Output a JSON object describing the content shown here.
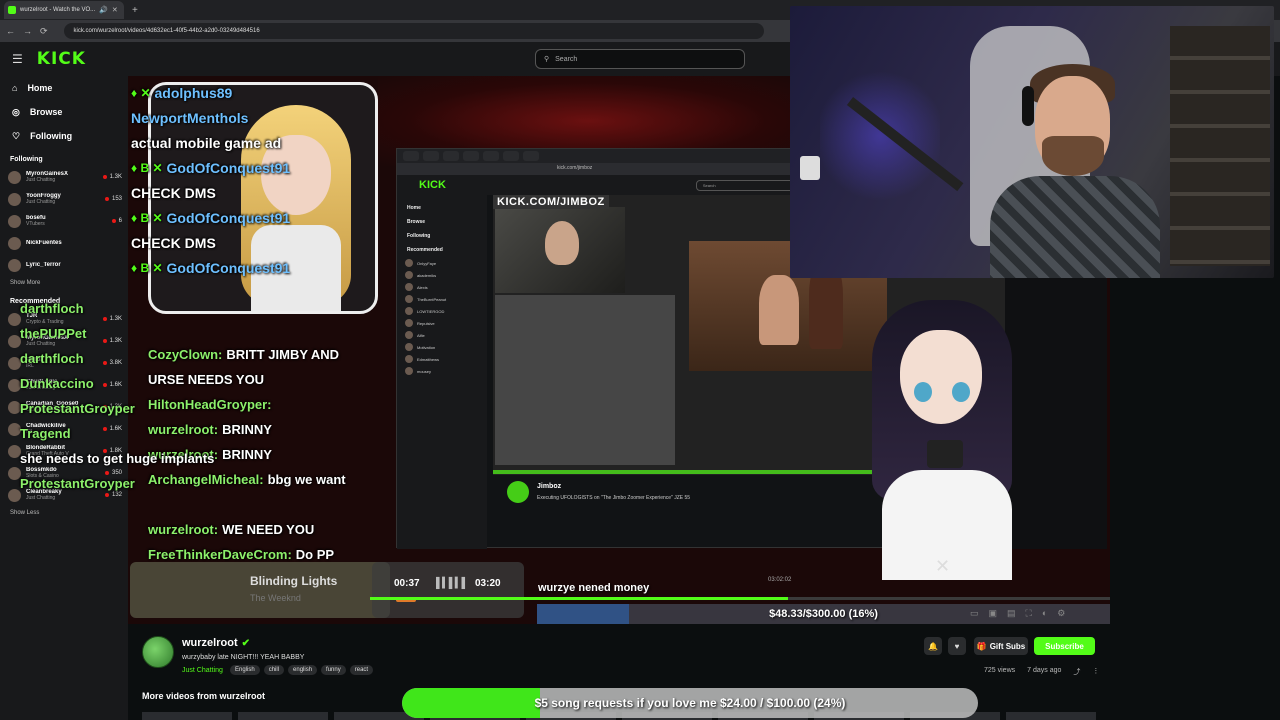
{
  "browser": {
    "tab_title": "wurzelroot - Watch the VO...",
    "url": "kick.com/wurzelroot/videos/4d632ec1-40f5-44b2-a2d0-03249d484516"
  },
  "header": {
    "logo": "KICK",
    "search_placeholder": "Search"
  },
  "sidebar": {
    "nav": [
      {
        "label": "Home",
        "icon": "home-icon"
      },
      {
        "label": "Browse",
        "icon": "compass-icon"
      },
      {
        "label": "Following",
        "icon": "heart-icon"
      }
    ],
    "following_title": "Following",
    "following": [
      {
        "name": "MyronGainesX",
        "cat": "Just Chatting",
        "count": "1.3K"
      },
      {
        "name": "YoonFroggy",
        "cat": "Just Chatting",
        "count": "153"
      },
      {
        "name": "bosefu",
        "cat": "VTubers",
        "count": "6"
      },
      {
        "name": "NickFuentes",
        "cat": "",
        "count": ""
      },
      {
        "name": "Lyric_Terror",
        "cat": "",
        "count": ""
      }
    ],
    "show_more": "Show More",
    "recommended_title": "Recommended",
    "recommended": [
      {
        "name": "TJR",
        "cat": "Crypto & Trading",
        "count": "1.3K"
      },
      {
        "name": "MyronGainesX",
        "cat": "Just Chatting",
        "count": "1.3K"
      },
      {
        "name": "Pellor",
        "cat": "IRL",
        "count": "3.8K"
      },
      {
        "name": "ChudLogic",
        "cat": "Just Chatting",
        "count": "1.6K"
      },
      {
        "name": "Canadian_Goose0",
        "cat": "Old School RuneScape",
        "count": "1.3K"
      },
      {
        "name": "Chadwickilive",
        "cat": "IRL",
        "count": "1.6K"
      },
      {
        "name": "BlondeRabbit",
        "cat": "Grand Theft Auto V",
        "count": "1.8K"
      },
      {
        "name": "Bossmkdo",
        "cat": "Slots & Casino",
        "count": "350"
      },
      {
        "name": "Cleanbreaky",
        "cat": "Just Chatting",
        "count": "132"
      }
    ],
    "show_less": "Show Less"
  },
  "overlay_chat": {
    "card_lines": [
      {
        "badges": "♦ ✕",
        "user": "adolphus89",
        "text": ""
      },
      {
        "badges": "",
        "user": "NewportMenthols",
        "text": ""
      },
      {
        "badges": "",
        "user": "",
        "text": "actual mobile game ad"
      },
      {
        "badges": "♦ B ✕",
        "user": "GodOfConquest91",
        "text": ""
      },
      {
        "badges": "",
        "user": "",
        "text": "CHECK DMS"
      },
      {
        "badges": "♦ B ✕",
        "user": "GodOfConquest91",
        "text": ""
      },
      {
        "badges": "",
        "user": "",
        "text": "CHECK DMS"
      },
      {
        "badges": "♦ B ✕",
        "user": "GodOfConquest91",
        "text": ""
      }
    ],
    "lines": [
      {
        "user": "CozyClown:",
        "text": "BRITT JIMBY AND"
      },
      {
        "user": "",
        "text": "URSE NEEDS YOU"
      },
      {
        "user": "HiltonHeadGroyper:",
        "text": ""
      },
      {
        "user": "wurzelroot:",
        "text": "BRINNY"
      },
      {
        "user": "wurzelroot:",
        "text": "BRINNY"
      },
      {
        "user": "ArchangelMicheal:",
        "text": "bbg we want"
      },
      {
        "user": "",
        "text": ""
      },
      {
        "user": "wurzelroot:",
        "text": "WE NEED YOU"
      },
      {
        "user": "FreeThinkerDaveCrom:",
        "text": "Do PP"
      }
    ],
    "left_lines": [
      {
        "user": "darthfloch",
        "text": ""
      },
      {
        "user": "thePUPPet",
        "text": ""
      },
      {
        "user": "darthfloch",
        "text": ""
      },
      {
        "user": "Dunkaccino",
        "text": ""
      },
      {
        "user": "ProtestantGroyper",
        "text": ""
      },
      {
        "user": "Tragend",
        "text": ""
      },
      {
        "user": "",
        "text": "she needs to get huge implants"
      },
      {
        "user": "ProtestantGroyper",
        "text": ""
      }
    ]
  },
  "inner_browser": {
    "logo": "KICK",
    "search": "Search",
    "channel_banner": "KICK.COM/JIMBOZ",
    "streamer_name": "Jimboz",
    "streamer_title": "Executing UFOLOGISTS on \"The Jimbo Zoomer Experience\" JZE 55",
    "nav": [
      "Home",
      "Browse",
      "Following"
    ],
    "recommended_label": "Recommended",
    "rows": [
      "OnlyyFaye",
      "akademiks",
      "Alexis",
      "TheBurntPeanut",
      "LOWTIERGOD",
      "Repulsive",
      "Alfie",
      "Motivation",
      "Edmatthews",
      "mousey"
    ]
  },
  "music": {
    "song": "Blinding Lights",
    "artist": "The Weeknd",
    "current_time": "00:37",
    "total_time": "03:20",
    "progress": 0.185
  },
  "video": {
    "progress": 0.565,
    "timestamp": "03:02:02"
  },
  "money_goal": {
    "title": "wurzye nened money",
    "label": "$48.33/$300.00 (16%)",
    "fraction": 0.16
  },
  "channel": {
    "name": "wurzelroot",
    "title": "wurzybaby late NIGHT!!! YEAH BABBY",
    "category": "Just Chatting",
    "tags": [
      "English",
      "chill",
      "english",
      "funny",
      "react"
    ],
    "gift_label": "Gift Subs",
    "subscribe_label": "Subscribe",
    "views": "725 views",
    "ago": "7 days ago",
    "more_videos": "More videos from wurzelroot"
  },
  "song_goal": {
    "label": "$5 song requests if you love me $24.00 / $100.00 (24%)",
    "fraction": 0.24
  },
  "colors": {
    "kick_green": "#53fc18",
    "bg": "#0b0e0f"
  }
}
